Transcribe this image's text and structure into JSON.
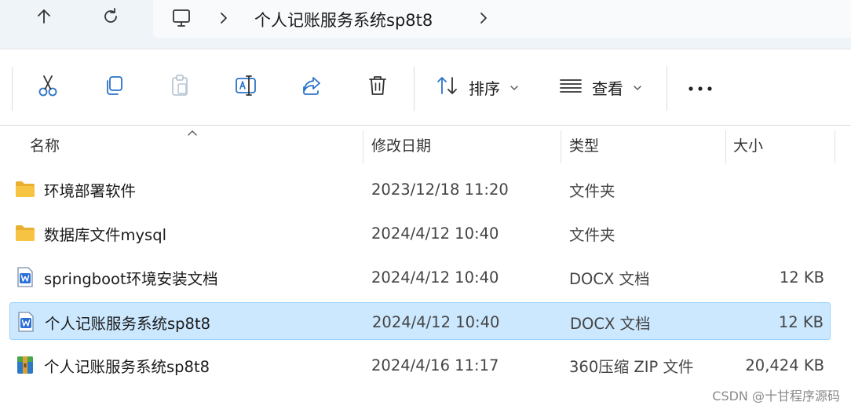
{
  "nav": {
    "up_icon": "arrow-up-icon",
    "refresh_icon": "refresh-icon",
    "pc_icon": "this-pc-icon"
  },
  "breadcrumb": {
    "current": "个人记账服务系统sp8t8"
  },
  "toolbar": {
    "cut_icon": "scissors-icon",
    "copy_icon": "copy-icon",
    "paste_icon": "clipboard-icon",
    "rename_icon": "rename-icon",
    "share_icon": "share-icon",
    "delete_icon": "trash-icon",
    "sort_label": "排序",
    "view_label": "查看",
    "more_icon": "more-icon"
  },
  "columns": {
    "name": "名称",
    "date": "修改日期",
    "type": "类型",
    "size": "大小"
  },
  "files": [
    {
      "name": "环境部署软件",
      "date": "2023/12/18 11:20",
      "type": "文件夹",
      "size": "",
      "icon": "folder-icon",
      "selected": false
    },
    {
      "name": "数据库文件mysql",
      "date": "2024/4/12 10:40",
      "type": "文件夹",
      "size": "",
      "icon": "folder-icon",
      "selected": false
    },
    {
      "name": "springboot环境安装文档",
      "date": "2024/4/12 10:40",
      "type": "DOCX 文档",
      "size": "12 KB",
      "icon": "docx-icon",
      "selected": false
    },
    {
      "name": "个人记账服务系统sp8t8",
      "date": "2024/4/12 10:40",
      "type": "DOCX 文档",
      "size": "12 KB",
      "icon": "docx-icon",
      "selected": true
    },
    {
      "name": "个人记账服务系统sp8t8",
      "date": "2024/4/16 11:17",
      "type": "360压缩 ZIP 文件",
      "size": "20,424 KB",
      "icon": "zip-archive-icon",
      "selected": false
    }
  ],
  "watermark": "CSDN @十甘程序源码",
  "colors": {
    "selection_bg": "#cce8ff",
    "selection_border": "#99d1ff",
    "folder": "#f6c343",
    "docx_blue": "#2b6fd6",
    "share_blue": "#2a73c9"
  }
}
